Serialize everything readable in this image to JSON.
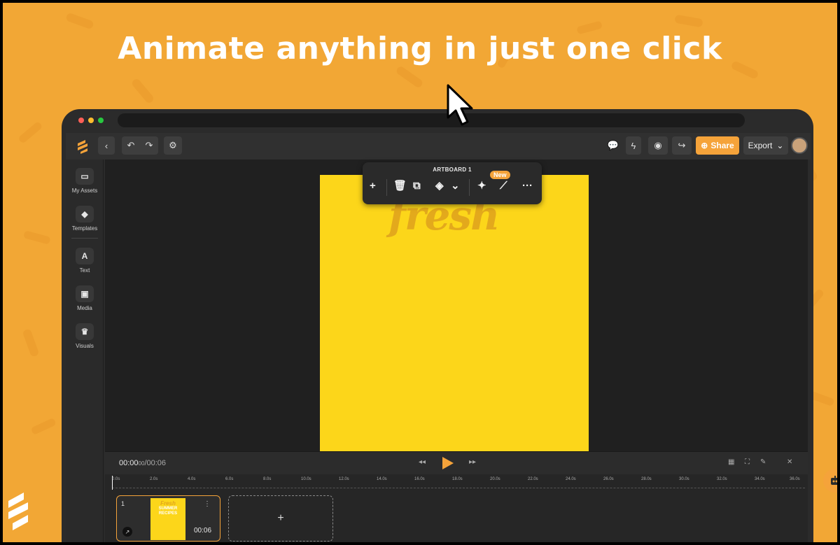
{
  "headline": "Animate anything in just one click",
  "colors": {
    "accent": "#f5a33a",
    "background": "#f2a735",
    "artboard": "#fcd61a",
    "app_dark": "#2b2b2b"
  },
  "toolbar": {
    "icons": [
      "back-icon",
      "undo-icon",
      "redo-icon",
      "settings-icon",
      "comment-icon",
      "lightning-icon",
      "preview-icon",
      "forward-icon"
    ],
    "share_label": "Share",
    "export_label": "Export"
  },
  "sidebar": {
    "items": [
      {
        "label": "My Assets",
        "icon": "folder-icon"
      },
      {
        "label": "Templates",
        "icon": "templates-icon"
      },
      {
        "label": "Text",
        "icon": "text-icon"
      },
      {
        "label": "Media",
        "icon": "media-icon"
      },
      {
        "label": "Visuals",
        "icon": "visuals-icon"
      }
    ]
  },
  "float_toolbar": {
    "title": "ARTBOARD 1",
    "new_badge": "New",
    "icons": [
      "add-icon",
      "delete-icon",
      "duplicate-icon",
      "fill-icon",
      "chevron-down-icon",
      "magic-wand-icon",
      "animate-icon",
      "more-icon"
    ]
  },
  "artboard": {
    "text": "fresh"
  },
  "timeline": {
    "current_time": "00:00",
    "current_frac": "00",
    "separator": "/",
    "total_time": "00:06",
    "ticks": [
      "0.0s",
      "2.0s",
      "4.0s",
      "6.0s",
      "8.0s",
      "10.0s",
      "12.0s",
      "14.0s",
      "16.0s",
      "18.0s",
      "20.0s",
      "22.0s",
      "24.0s",
      "26.0s",
      "28.0s",
      "30.0s",
      "32.0s",
      "34.0s",
      "36.0s"
    ],
    "clip": {
      "number": "1",
      "duration": "00:06",
      "thumb_title": "Fresh",
      "thumb_subtitle": "SUMMER RECIPES"
    },
    "add_label": "+"
  }
}
